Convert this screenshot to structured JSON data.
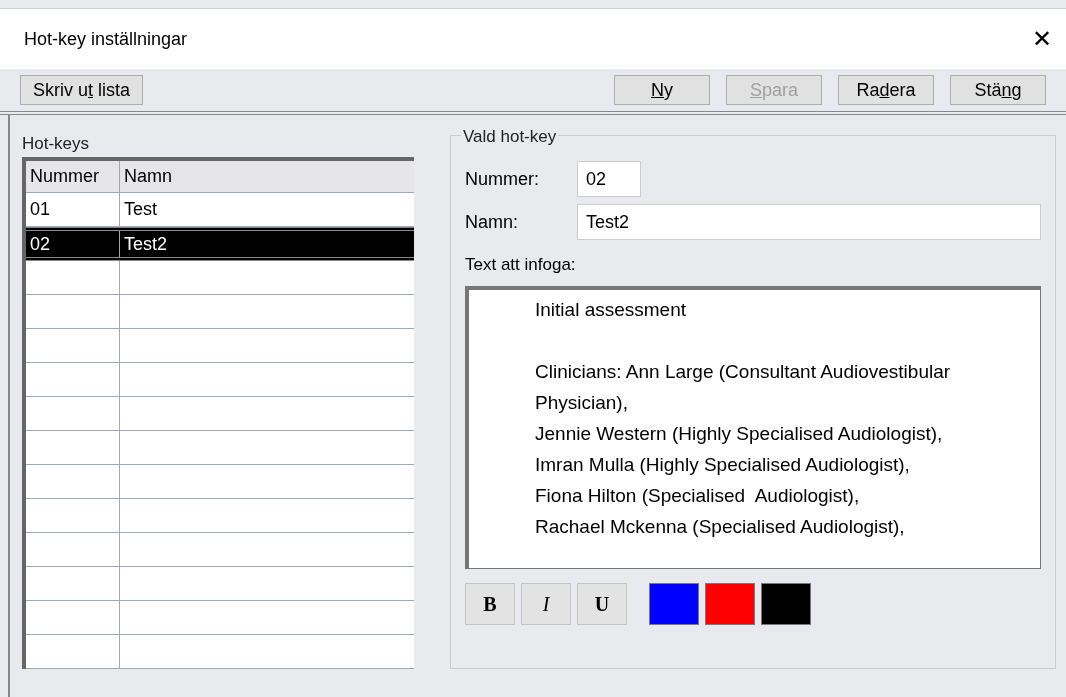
{
  "window": {
    "title": "Hot-key inställningar",
    "close": "✕"
  },
  "toolbar": {
    "left": [
      {
        "before": "Skriv u",
        "key": "t",
        "after": " lista",
        "disabled": false
      }
    ],
    "right": [
      {
        "key": "N",
        "after": "y",
        "disabled": false
      },
      {
        "key": "S",
        "after": "para",
        "disabled": true
      },
      {
        "before": "Ra",
        "key": "d",
        "after": "era",
        "disabled": false
      },
      {
        "before": "Stä",
        "key": "n",
        "after": "g",
        "disabled": false
      }
    ]
  },
  "list": {
    "title": "Hot-keys",
    "columns": [
      "Nummer",
      "Namn"
    ],
    "rows": [
      {
        "cells": [
          "01",
          "Test"
        ],
        "selected": false
      },
      {
        "cells": [
          "02",
          "Test2"
        ],
        "selected": true
      }
    ]
  },
  "detail": {
    "title": "Vald hot-key",
    "number_label": "Nummer:",
    "number_value": "02",
    "name_label": "Namn:",
    "name_value": "Test2",
    "text_label": "Text att infoga:",
    "content": [
      {
        "kind": "heading",
        "text": "Initial assessment"
      },
      {
        "kind": "line",
        "text": "Clinicians: Ann Large (Consultant Audiovestibular Physician),"
      },
      {
        "kind": "line",
        "text": "Jennie Western (Highly Specialised Audiologist),"
      },
      {
        "kind": "line",
        "text": "Imran Mulla (Highly Specialised Audiologist),"
      },
      {
        "kind": "line",
        "text": "Fiona Hilton (Specialised  Audiologist),"
      },
      {
        "kind": "line",
        "text": "Rachael Mckenna (Specialised Audiologist),"
      }
    ],
    "format_buttons": [
      {
        "label": "B",
        "kind": "bold"
      },
      {
        "label": "I",
        "kind": "italic"
      },
      {
        "label": "U",
        "kind": "underline"
      }
    ],
    "colors": [
      {
        "color": "#0000ff"
      },
      {
        "color": "#ff0000"
      },
      {
        "color": "#000000"
      }
    ]
  }
}
